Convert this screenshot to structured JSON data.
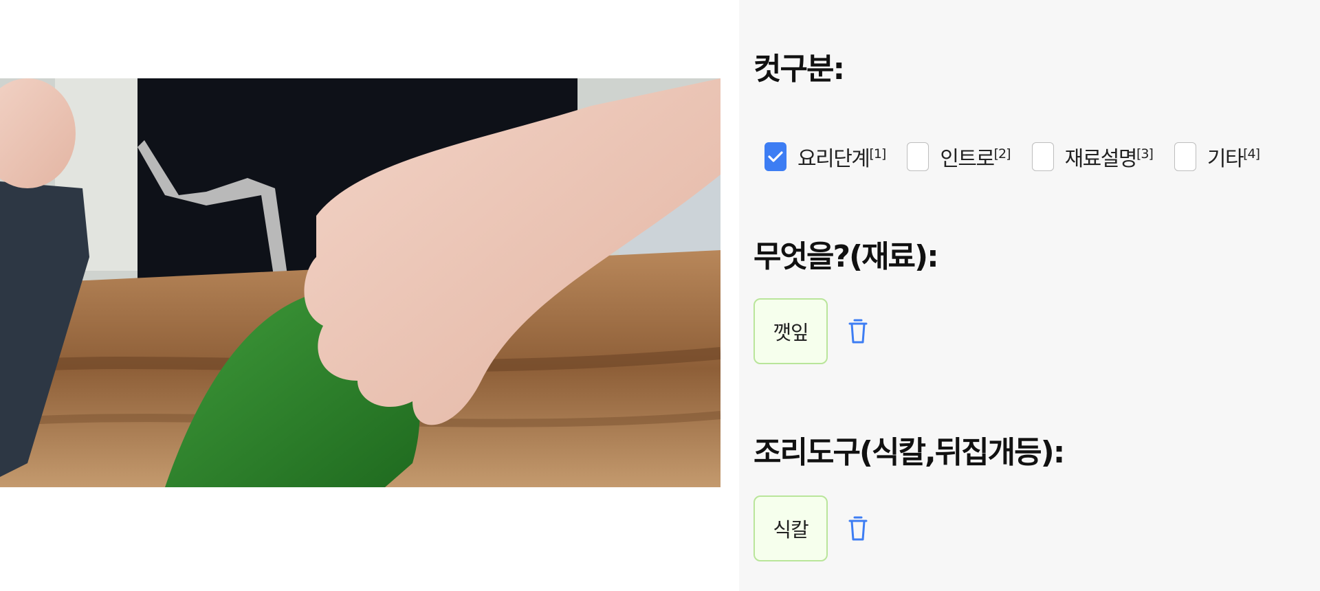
{
  "colors": {
    "accent": "#3d7df3",
    "chip_border": "#b9e59a",
    "chip_bg": "#f6ffed",
    "panel_bg": "#f7f7f7",
    "trash_icon": "#3d7df3"
  },
  "video": {
    "icon": "video-frame"
  },
  "cut_type": {
    "title": "컷구분:",
    "options": [
      {
        "label": "요리단계",
        "note": "[1]",
        "checked": true
      },
      {
        "label": "인트로",
        "note": "[2]",
        "checked": false
      },
      {
        "label": "재료설명",
        "note": "[3]",
        "checked": false
      },
      {
        "label": "기타",
        "note": "[4]",
        "checked": false
      }
    ]
  },
  "ingredients": {
    "title": "무엇을?(재료):",
    "items": [
      {
        "label": "깻잎",
        "delete_icon": "trash-icon"
      }
    ]
  },
  "tools": {
    "title": "조리도구(식칼,뒤집개등):",
    "items": [
      {
        "label": "식칼",
        "delete_icon": "trash-icon"
      }
    ]
  }
}
